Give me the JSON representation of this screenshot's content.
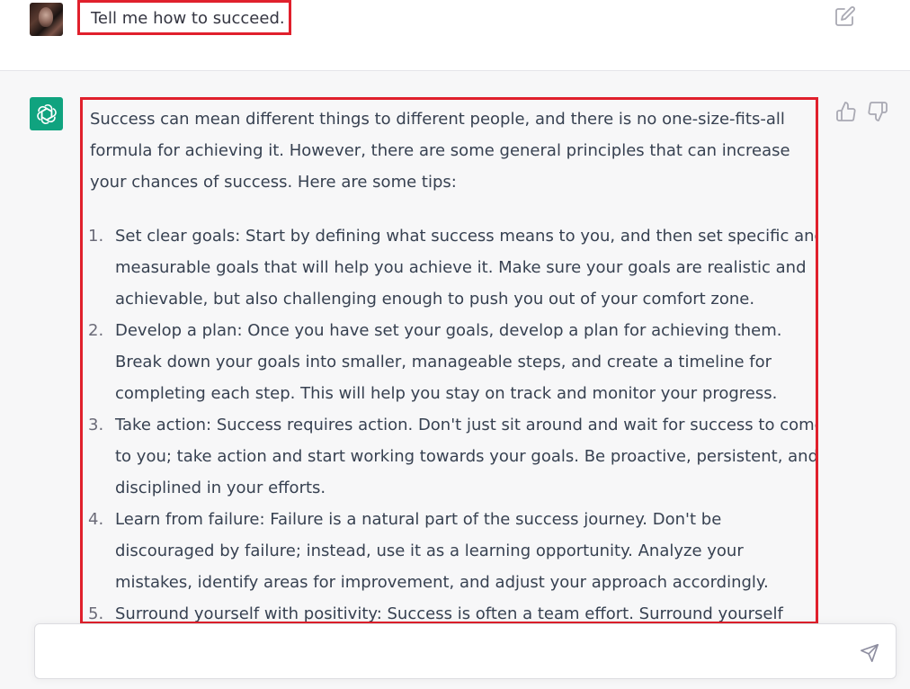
{
  "user_message": {
    "text": "Tell me how to succeed."
  },
  "assistant_message": {
    "intro": "Success can mean different things to different people, and there is no one-size-fits-all formula for achieving it. However, there are some general principles that can increase your chances of success. Here are some tips:",
    "tips": [
      {
        "number": "1.",
        "text": "Set clear goals: Start by defining what success means to you, and then set specific and measurable goals that will help you achieve it. Make sure your goals are realistic and achievable, but also challenging enough to push you out of your comfort zone."
      },
      {
        "number": "2.",
        "text": "Develop a plan: Once you have set your goals, develop a plan for achieving them. Break down your goals into smaller, manageable steps, and create a timeline for completing each step. This will help you stay on track and monitor your progress."
      },
      {
        "number": "3.",
        "text": "Take action: Success requires action. Don't just sit around and wait for success to come to you; take action and start working towards your goals. Be proactive, persistent, and disciplined in your efforts."
      },
      {
        "number": "4.",
        "text": "Learn from failure: Failure is a natural part of the success journey. Don't be discouraged by failure; instead, use it as a learning opportunity. Analyze your mistakes, identify areas for improvement, and adjust your approach accordingly."
      },
      {
        "number": "5.",
        "text": "Surround yourself with positivity: Success is often a team effort. Surround yourself"
      }
    ]
  },
  "input": {
    "value": "",
    "placeholder": ""
  },
  "icons": {
    "edit": "edit-icon",
    "thumbs_up": "thumbs-up-icon",
    "thumbs_down": "thumbs-down-icon",
    "send": "send-icon",
    "assistant_logo": "openai-logo-icon"
  },
  "colors": {
    "highlight_border": "#e0202c",
    "assistant_avatar_bg": "#10a37f",
    "assistant_row_bg": "#f7f7f8"
  }
}
